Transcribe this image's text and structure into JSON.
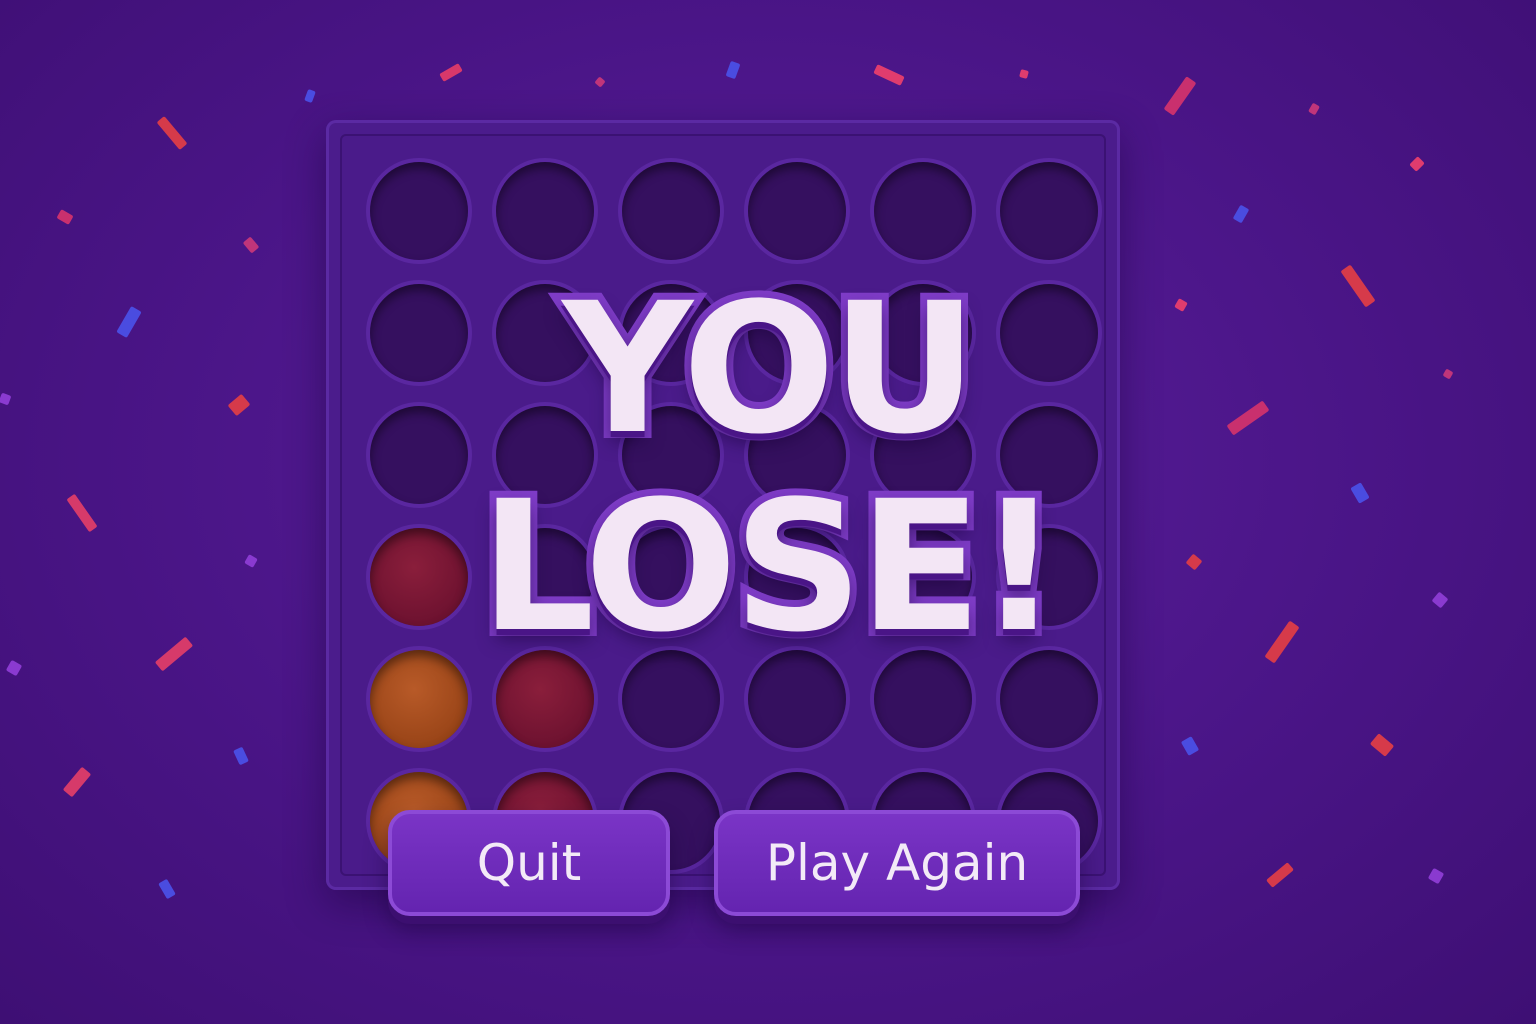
{
  "game": {
    "title_line1": "YOU",
    "title_line2": "LOSE!",
    "board": {
      "columns": 6,
      "rows": 6,
      "cells": [
        [
          "empty",
          "empty",
          "empty",
          "empty",
          "empty",
          "empty"
        ],
        [
          "empty",
          "empty",
          "empty",
          "empty",
          "empty",
          "empty"
        ],
        [
          "empty",
          "empty",
          "empty",
          "empty",
          "empty",
          "empty"
        ],
        [
          "red",
          "empty",
          "empty",
          "empty",
          "empty",
          "empty"
        ],
        [
          "orange",
          "red",
          "empty",
          "empty",
          "empty",
          "empty"
        ],
        [
          "orange",
          "red",
          "empty",
          "empty",
          "empty",
          "empty"
        ]
      ]
    }
  },
  "buttons": {
    "quit_label": "Quit",
    "play_again_label": "Play Again"
  },
  "colors": {
    "background": "#4a1587",
    "board": "#4b1c8c",
    "red_piece": "#6e1230",
    "orange_piece": "#9a4518",
    "title_text": "#f3e6f5",
    "title_outline": "#7f3cc8",
    "button": "#6424b0"
  },
  "decor": {
    "confetti": "confetti-pieces"
  }
}
